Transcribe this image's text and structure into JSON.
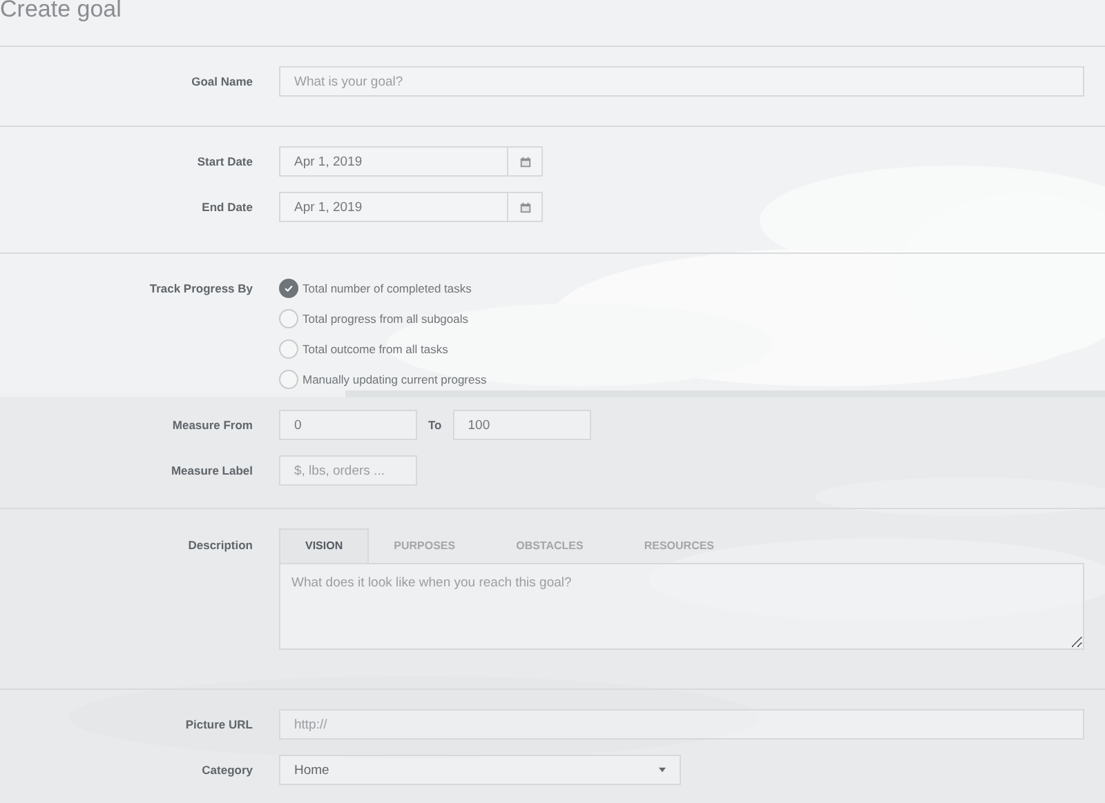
{
  "page": {
    "title": "Create goal"
  },
  "sections": [
    {
      "rows": [
        {
          "kind": "text",
          "label": "Goal Name",
          "placeholder": "What is your goal?"
        }
      ]
    },
    {
      "rows": [
        {
          "kind": "date",
          "label": "Start Date",
          "value": "Apr 1, 2019"
        },
        {
          "kind": "date",
          "label": "End Date",
          "value": "Apr 1, 2019"
        }
      ]
    },
    {
      "rows": [
        {
          "kind": "radios",
          "label": "Track Progress By",
          "options": [
            {
              "label": "Total number of completed tasks",
              "selected": true
            },
            {
              "label": "Total progress from all subgoals",
              "selected": false
            },
            {
              "label": "Total outcome from all tasks",
              "selected": false
            },
            {
              "label": "Manually updating current progress",
              "selected": false
            }
          ]
        },
        {
          "kind": "range",
          "label": "Measure From",
          "from_value": "0",
          "to_label": "To",
          "to_value": "100"
        },
        {
          "kind": "short",
          "label": "Measure Label",
          "placeholder": "$, lbs, orders ..."
        }
      ]
    },
    {
      "rows": [
        {
          "kind": "tabs",
          "label": "Description",
          "tabs": [
            {
              "label": "VISION",
              "selected": true
            },
            {
              "label": "PURPOSES",
              "selected": false
            },
            {
              "label": "OBSTACLES",
              "selected": false
            },
            {
              "label": "RESOURCES",
              "selected": false
            }
          ],
          "placeholder": "What does it look like when you reach this goal?"
        }
      ]
    },
    {
      "rows": [
        {
          "kind": "text",
          "label": "Picture URL",
          "placeholder": "http://"
        },
        {
          "kind": "select",
          "label": "Category",
          "value": "Home"
        }
      ]
    }
  ]
}
